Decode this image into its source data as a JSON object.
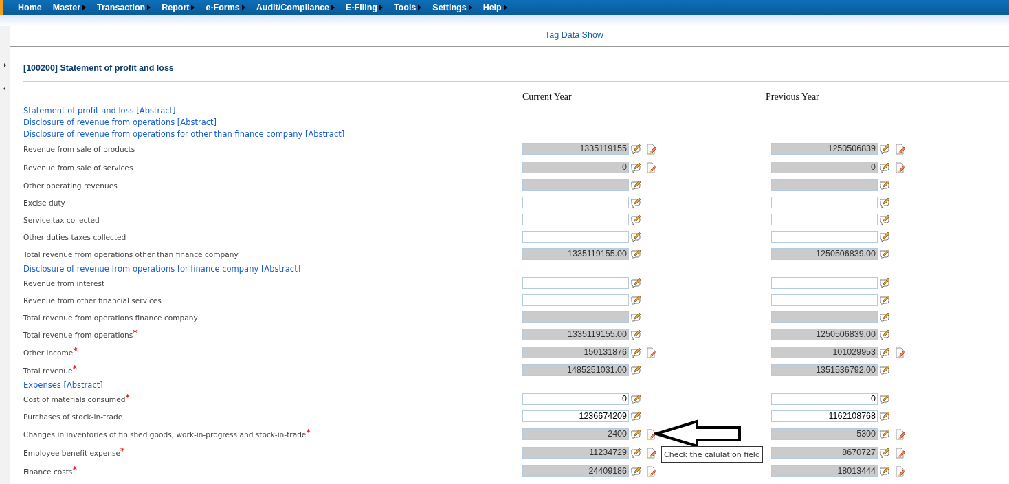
{
  "menu": [
    {
      "label": "Home",
      "has_submenu": false
    },
    {
      "label": "Master",
      "has_submenu": true
    },
    {
      "label": "Transaction",
      "has_submenu": true
    },
    {
      "label": "Report",
      "has_submenu": true
    },
    {
      "label": "e-Forms",
      "has_submenu": true
    },
    {
      "label": "Audit/Compliance",
      "has_submenu": true
    },
    {
      "label": "E-Filing",
      "has_submenu": true
    },
    {
      "label": "Tools",
      "has_submenu": true
    },
    {
      "label": "Settings",
      "has_submenu": true
    },
    {
      "label": "Help",
      "has_submenu": true
    }
  ],
  "tag_link": "Tag Data Show",
  "section_title": "[100200] Statement of profit and loss",
  "columns": [
    "Current Year",
    "Previous Year"
  ],
  "rows": [
    {
      "kind": "abstract",
      "label": "Statement of profit and loss [Abstract]"
    },
    {
      "kind": "abstract",
      "label": "Disclosure of revenue from operations [Abstract]"
    },
    {
      "kind": "abstract",
      "label": "Disclosure of revenue from operations for other than finance company [Abstract]"
    },
    {
      "kind": "item",
      "label": "Revenue from sale of products",
      "cells": [
        {
          "value": "1335119155",
          "editable": false,
          "doc": true
        },
        {
          "value": "1250506839",
          "editable": false,
          "doc": true
        }
      ]
    },
    {
      "kind": "item",
      "label": "Revenue from sale of services",
      "cells": [
        {
          "value": "0",
          "editable": false,
          "doc": true
        },
        {
          "value": "0",
          "editable": false,
          "doc": true
        }
      ]
    },
    {
      "kind": "item",
      "label": "Other operating revenues",
      "cells": [
        {
          "editable": false,
          "doc": false
        },
        {
          "editable": false,
          "doc": false
        }
      ]
    },
    {
      "kind": "item",
      "label": "Excise duty",
      "cells": [
        {
          "editable": true,
          "doc": false
        },
        {
          "editable": true,
          "doc": false
        }
      ]
    },
    {
      "kind": "item",
      "label": "Service tax collected",
      "cells": [
        {
          "editable": true,
          "doc": false
        },
        {
          "editable": true,
          "doc": false
        }
      ]
    },
    {
      "kind": "item",
      "label": "Other duties taxes collected",
      "cells": [
        {
          "editable": true,
          "doc": false
        },
        {
          "editable": true,
          "doc": false
        }
      ]
    },
    {
      "kind": "item",
      "label": "Total revenue from operations other than finance company",
      "cells": [
        {
          "value": "1335119155.00",
          "editable": false,
          "doc": false
        },
        {
          "value": "1250506839.00",
          "editable": false,
          "doc": false
        }
      ]
    },
    {
      "kind": "abstract",
      "label": "Disclosure of revenue from operations for finance company [Abstract]"
    },
    {
      "kind": "item",
      "label": "Revenue from interest",
      "cells": [
        {
          "editable": true,
          "doc": false
        },
        {
          "editable": true,
          "doc": false
        }
      ]
    },
    {
      "kind": "item",
      "label": "Revenue from other financial services",
      "cells": [
        {
          "editable": true,
          "doc": false
        },
        {
          "editable": true,
          "doc": false
        }
      ]
    },
    {
      "kind": "item",
      "label": "Total revenue from operations finance company",
      "cells": [
        {
          "editable": false,
          "doc": false
        },
        {
          "editable": false,
          "doc": false
        }
      ]
    },
    {
      "kind": "item",
      "label": "Total revenue from operations$^{*}$",
      "cells": [
        {
          "value": "1335119155.00",
          "editable": false,
          "doc": false
        },
        {
          "value": "1250506839.00",
          "editable": false,
          "doc": false
        }
      ]
    },
    {
      "kind": "item",
      "label": "Other income$^{*}$",
      "cells": [
        {
          "value": "150131876",
          "editable": false,
          "doc": true
        },
        {
          "value": "101029953",
          "editable": false,
          "doc": true
        }
      ]
    },
    {
      "kind": "item",
      "label": "Total revenue$^{*}$",
      "cells": [
        {
          "value": "1485251031.00",
          "editable": false,
          "doc": false
        },
        {
          "value": "1351536792.00",
          "editable": false,
          "doc": false
        }
      ]
    },
    {
      "kind": "abstract",
      "label": "Expenses [Abstract]"
    },
    {
      "kind": "item",
      "label": "Cost of materials consumed$^{*}$",
      "cells": [
        {
          "value": "0",
          "editable": true,
          "doc": false
        },
        {
          "value": "0",
          "editable": true,
          "doc": false
        }
      ]
    },
    {
      "kind": "item",
      "label": "Purchases of stock-in-trade",
      "cells": [
        {
          "value": "1236674209",
          "editable": true,
          "doc": false
        },
        {
          "value": "1162108768",
          "editable": true,
          "doc": false
        }
      ]
    },
    {
      "kind": "item",
      "label": "Changes in inventories of finished goods, work-in-progress and stock-in-trade$^{*}$",
      "cells": [
        {
          "value": "2400",
          "editable": false,
          "doc": true
        },
        {
          "value": "5300",
          "editable": false,
          "doc": true
        }
      ]
    },
    {
      "kind": "item",
      "label": "Employee benefit expense$^{*}$",
      "cells": [
        {
          "value": "11234729",
          "editable": false,
          "doc": true
        },
        {
          "value": "8670727",
          "editable": false,
          "doc": true
        }
      ]
    },
    {
      "kind": "item",
      "label": "Finance costs$^{*}$",
      "cells": [
        {
          "value": "24409186",
          "editable": false,
          "doc": true
        },
        {
          "value": "18013444",
          "editable": false,
          "doc": true
        }
      ]
    }
  ],
  "tooltip": {
    "text": "Check the calulation field"
  }
}
